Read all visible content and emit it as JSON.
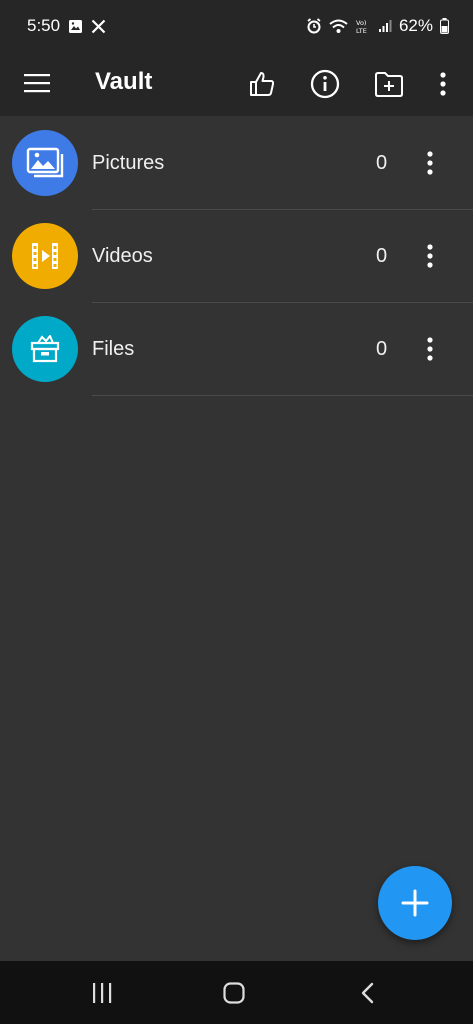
{
  "status_bar": {
    "time": "5:50",
    "battery_percent": "62%",
    "icons": [
      "image-icon",
      "x-logo-icon",
      "alarm-icon",
      "wifi-icon",
      "volte-icon",
      "signal-icon",
      "battery-icon"
    ]
  },
  "app_bar": {
    "title": "Vault",
    "actions": [
      "thumbs-up-icon",
      "info-icon",
      "add-folder-icon",
      "more-vertical-icon"
    ]
  },
  "folders": [
    {
      "label": "Pictures",
      "count": "0",
      "icon": "pictures-icon",
      "color": "#3f7be6"
    },
    {
      "label": "Videos",
      "count": "0",
      "icon": "video-icon",
      "color": "#f0ac00"
    },
    {
      "label": "Files",
      "count": "0",
      "icon": "files-box-icon",
      "color": "#00a9c7"
    }
  ],
  "fab": {
    "icon": "plus-icon",
    "color": "#2196f3"
  },
  "nav_bar": {
    "buttons": [
      "recent-apps-icon",
      "home-icon",
      "back-icon"
    ]
  }
}
